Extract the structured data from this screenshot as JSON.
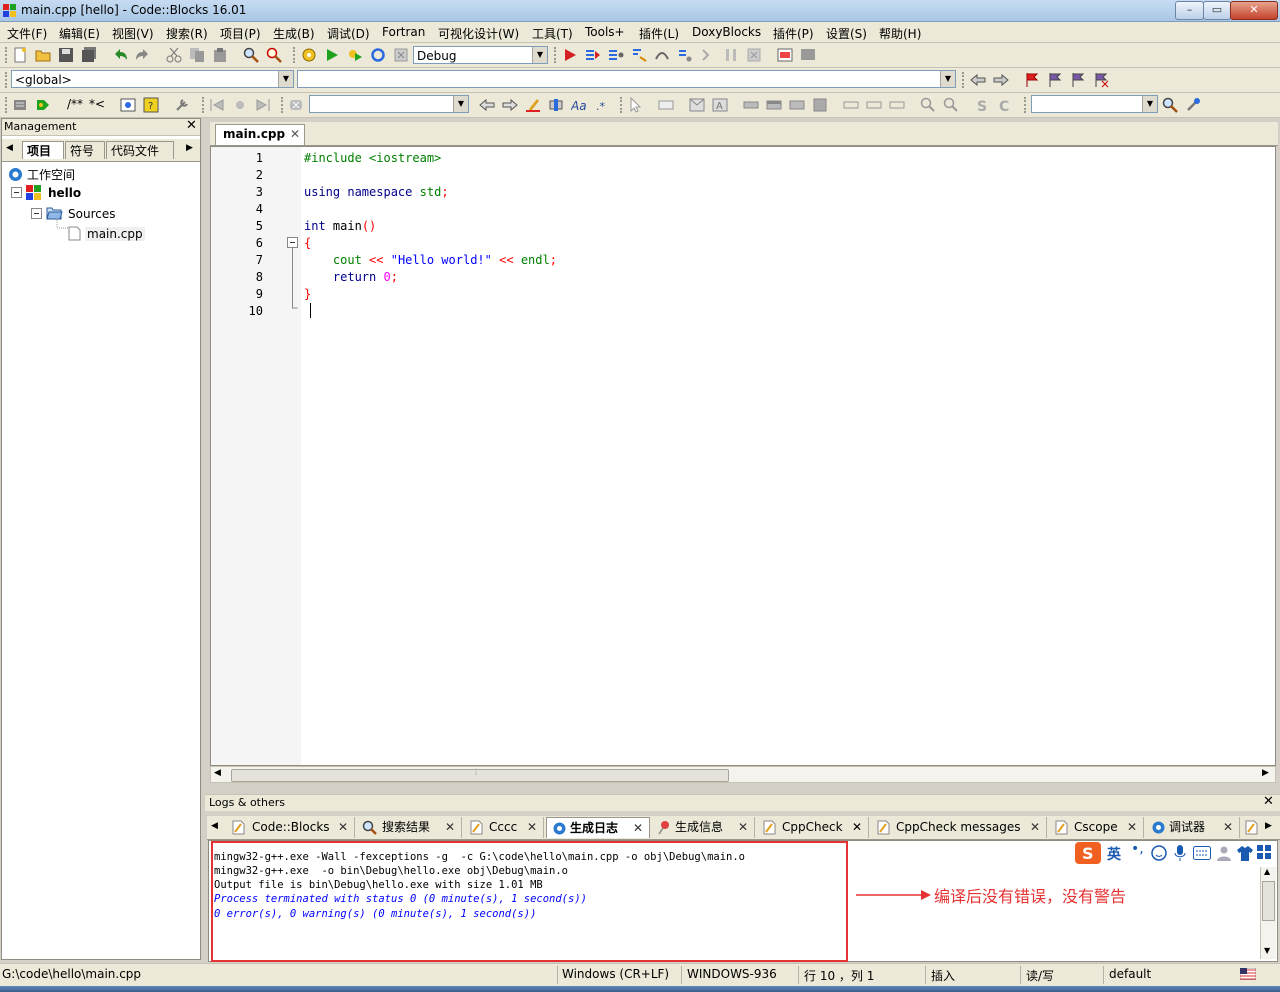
{
  "window": {
    "title": "main.cpp [hello] - Code::Blocks 16.01",
    "minimize": "–",
    "maximize": "▭",
    "close": "✕"
  },
  "menu": [
    "文件(F)",
    "编辑(E)",
    "视图(V)",
    "搜索(R)",
    "项目(P)",
    "生成(B)",
    "调试(D)",
    "Fortran",
    "可视化设计(W)",
    "工具(T)",
    "Tools+",
    "插件(L)",
    "DoxyBlocks",
    "插件(P)",
    "设置(S)",
    "帮助(H)"
  ],
  "toolbar": {
    "build_target": "Debug",
    "scope": "<global>",
    "doxy_comment": "/**",
    "doxy_line": "*<"
  },
  "management": {
    "title": "Management",
    "tabs": [
      "项目",
      "符号",
      "代码文件"
    ],
    "tree": {
      "workspace": "工作空间",
      "project": "hello",
      "folder": "Sources",
      "file": "main.cpp"
    }
  },
  "editor": {
    "tab": "main.cpp",
    "line_numbers": [
      "1",
      "2",
      "3",
      "4",
      "5",
      "6",
      "7",
      "8",
      "9",
      "10"
    ],
    "lines": {
      "l1": "#include <iostream>",
      "l3a": "using",
      "l3b": "namespace",
      "l3c": "std",
      "l3d": ";",
      "l5a": "int",
      "l5b": " main",
      "l5c": "()",
      "l6": "{",
      "l7a": "cout",
      "l7b": "<<",
      "l7c": "\"Hello world!\"",
      "l7d": "<<",
      "l7e": "endl",
      "l7f": ";",
      "l8a": "return",
      "l8b": "0",
      "l8c": ";",
      "l9": "}"
    },
    "hscroll_grip": "⦙"
  },
  "logs": {
    "title": "Logs & others",
    "tabs": [
      "Code::Blocks",
      "搜索结果",
      "Cccc",
      "生成日志",
      "生成信息",
      "CppCheck",
      "CppCheck messages",
      "Cscope",
      "调试器"
    ],
    "active_tab": "生成日志",
    "lines": [
      "mingw32-g++.exe -Wall -fexceptions -g  -c G:\\code\\hello\\main.cpp -o obj\\Debug\\main.o",
      "mingw32-g++.exe  -o bin\\Debug\\hello.exe obj\\Debug\\main.o",
      "Output file is bin\\Debug\\hello.exe with size 1.01 MB",
      "Process terminated with status 0 (0 minute(s), 1 second(s))",
      "0 error(s), 0 warning(s) (0 minute(s), 1 second(s))"
    ],
    "annotation": "编译后没有错误，没有警告",
    "ime_label": "英"
  },
  "status": {
    "path": "G:\\code\\hello\\main.cpp",
    "eol": "Windows (CR+LF)",
    "encoding": "WINDOWS-936",
    "position": "行 10 ，列 1",
    "mode": "插入",
    "rw": "读/写",
    "style": "default"
  },
  "colors": {
    "annotation_red": "#e53333",
    "keyword": "#00008b",
    "string": "#0000ff",
    "preprocessor": "#008000",
    "operator": "#ff0000",
    "number": "#ff00ff"
  }
}
